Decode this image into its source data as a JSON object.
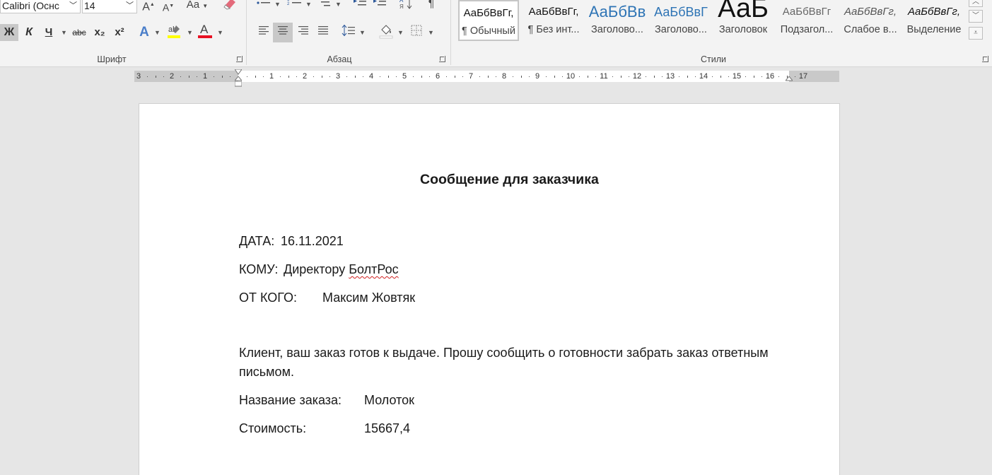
{
  "ribbon": {
    "font": {
      "font_name": "Calibri (Оснс",
      "font_size": "14",
      "grow_label": "A",
      "shrink_label": "A",
      "case_label": "Aa",
      "bold": "Ж",
      "italic": "К",
      "underline": "Ч",
      "strike": "abc",
      "subscript": "x₂",
      "superscript": "x²",
      "group_label": "Шрифт"
    },
    "paragraph": {
      "group_label": "Абзац",
      "pilcrow": "¶"
    },
    "styles": {
      "group_label": "Стили",
      "items": [
        {
          "sample": "АаБбВвГг,",
          "name": "¶ Обычный"
        },
        {
          "sample": "АаБбВвГг,",
          "name": "¶ Без инт..."
        },
        {
          "sample": "АаБбВв",
          "name": "Заголово..."
        },
        {
          "sample": "АаБбВвГ",
          "name": "Заголово..."
        },
        {
          "sample": "АаБ",
          "name": "Заголовок"
        },
        {
          "sample": "АаБбВвГг",
          "name": "Подзагол..."
        },
        {
          "sample": "АаБбВвГг,",
          "name": "Слабое в..."
        },
        {
          "sample": "АаБбВвГг,",
          "name": "Выделение"
        }
      ]
    }
  },
  "ruler": {
    "left_numbers": [
      "3",
      "2",
      "1"
    ],
    "right_numbers": [
      "1",
      "2",
      "3",
      "4",
      "5",
      "6",
      "7",
      "8",
      "9",
      "10",
      "11",
      "12",
      "13",
      "14",
      "15",
      "16",
      "17"
    ]
  },
  "document": {
    "title": "Сообщение для заказчика",
    "date_label": "ДАТА:",
    "date_value": "16.11.2021",
    "to_label": "КОМУ:",
    "to_value_prefix": "Директору",
    "to_value_company": "БолтРос",
    "from_label": "ОТ КОГО:",
    "from_value": "Максим Жовтяк",
    "body_line1": "Клиент, ваш заказ готов к выдаче. Прошу сообщить о готовности забрать заказ ответным",
    "body_line2": "письмом.",
    "order_label": "Название заказа:",
    "order_value": "Молоток",
    "cost_label": "Стоимость:",
    "cost_value": "15667,4"
  }
}
